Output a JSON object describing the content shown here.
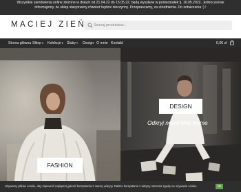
{
  "announcement": {
    "lines": [
      "Wszystkie zamówienia online złożone w dniach od 21.04.22 do 15.05.22, będą wysyłane w poniedziałek tj. 16.05.2022. Jednocześnie",
      "informujemy, że sklep stacjonarny również będzie nieczynny. Przepraszamy, za utrudnienia. Do zobaczenia :) !"
    ]
  },
  "header": {
    "logo": "MACIEJ ZIEŃ",
    "search_placeholder": "Szukaj produktów..."
  },
  "nav": {
    "items": [
      {
        "label": "Strona główna",
        "dropdown": false
      },
      {
        "label": "Sklep",
        "dropdown": true
      },
      {
        "label": "Kolekcje",
        "dropdown": true
      },
      {
        "label": "Śluby",
        "dropdown": true
      },
      {
        "label": "Design",
        "dropdown": false
      },
      {
        "label": "O mnie",
        "dropdown": false
      },
      {
        "label": "Kontakt",
        "dropdown": false
      }
    ],
    "caret": "▾",
    "cart_total": "0,00 zł"
  },
  "hero": {
    "fashion_label": "FASHION",
    "design_label": "DESIGN",
    "tagline": "Odkryj nową linię Home"
  },
  "cookie": {
    "text": "Używamy plików cookie, aby zapewnić najlepszą jakość korzystania z naszej witryny. Dalsze korzystanie z witryny oznacza zgodę na używanie cookie.",
    "ok_label": "Ok"
  },
  "colors": {
    "announcement_bg": "#2f2f2f",
    "nav_bg": "#2b2b2b",
    "cookie_bg": "#2e2e2e",
    "ok_button": "#5aa640"
  }
}
